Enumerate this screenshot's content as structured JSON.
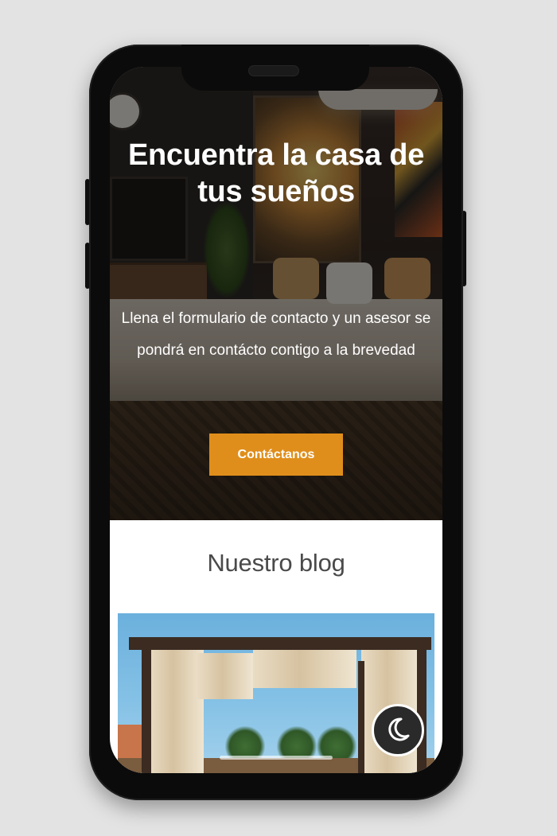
{
  "hero": {
    "title": "Encuentra la casa de tus sueños",
    "subtitle": "Llena el formulario de contacto y un asesor se pondrá en contácto contigo a la brevedad",
    "cta_label": "Contáctanos",
    "cta_color": "#e08e1b"
  },
  "blog": {
    "section_title": "Nuestro blog"
  },
  "floating": {
    "dark_mode_icon": "moon-icon"
  }
}
